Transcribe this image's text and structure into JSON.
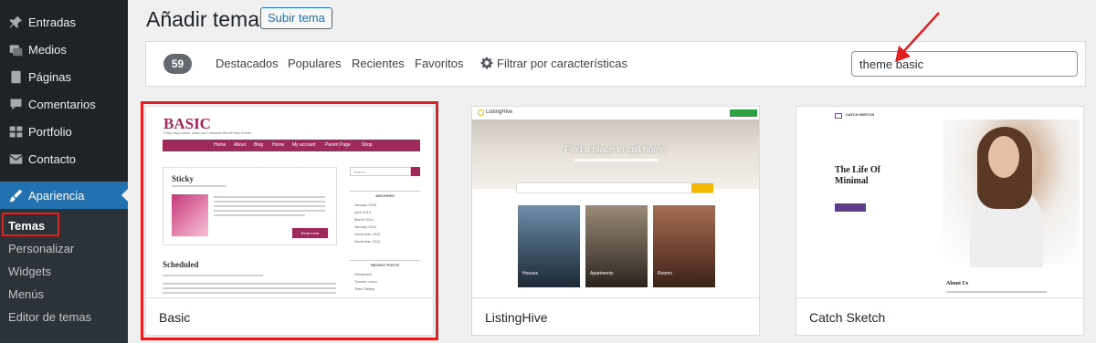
{
  "sidebar": {
    "items": [
      {
        "label": "Entradas",
        "icon": "pin-icon"
      },
      {
        "label": "Medios",
        "icon": "media-icon"
      },
      {
        "label": "Páginas",
        "icon": "page-icon"
      },
      {
        "label": "Comentarios",
        "icon": "comment-icon"
      },
      {
        "label": "Portfolio",
        "icon": "portfolio-icon"
      },
      {
        "label": "Contacto",
        "icon": "mail-icon"
      },
      {
        "label": "Apariencia",
        "icon": "brush-icon"
      }
    ],
    "submenu": [
      "Temas",
      "Personalizar",
      "Widgets",
      "Menús",
      "Editor de temas"
    ],
    "colors": {
      "bg": "#1d2327",
      "active": "#2271b1",
      "submenu_bg": "#2c3338"
    }
  },
  "header": {
    "title": "Añadir temas",
    "upload_label": "Subir tema"
  },
  "filters": {
    "count": "59",
    "links": [
      "Destacados",
      "Populares",
      "Recientes",
      "Favoritos"
    ],
    "feature_filter": "Filtrar por características",
    "search_value": "theme basic"
  },
  "themes": [
    {
      "name": "Basic",
      "preview": {
        "title": "BASIC",
        "tagline": "Fully responsive, clean and minimal WordPress theme",
        "nav": [
          "Home",
          "About",
          "Blog",
          "Home",
          "My account",
          "Parent Page",
          "Shop"
        ],
        "post_title": "Sticky",
        "read_more": "Read more",
        "scheduled": "Scheduled",
        "search_placeholder": "Search",
        "archives_heading": "ARCHIVES",
        "archives": [
          "January 2016",
          "April 2014",
          "March 2014",
          "January 2013",
          "December 2012",
          "November 2012"
        ],
        "recent_heading": "RECENT POSTS",
        "recent": [
          "Scheduled",
          "Tpower, sazol",
          "Tiled Gallery"
        ]
      }
    },
    {
      "name": "ListingHive",
      "preview": {
        "logo": "ListingHive",
        "hero_title": "Find a place to call home.",
        "tiles": [
          "Houses",
          "Apartments",
          "Rooms"
        ]
      }
    },
    {
      "name": "Catch Sketch",
      "preview": {
        "logo": "CATCH SKETCH",
        "heading": "The Life Of Minimal",
        "about": "About Us"
      }
    }
  ],
  "accent_colors": {
    "annotation": "#e02020",
    "basic_brand": "#9e2a5c"
  }
}
